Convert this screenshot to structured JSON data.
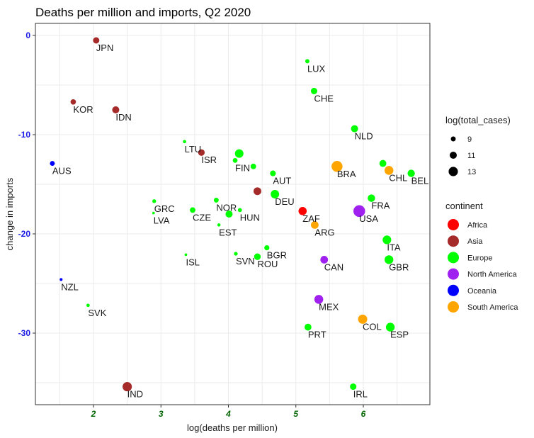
{
  "chart_data": {
    "type": "scatter",
    "title": "Deaths per million and imports, Q2 2020",
    "xlabel": "log(deaths per million)",
    "ylabel": "change in imports",
    "xlim": [
      1.2,
      7.0
    ],
    "ylim": [
      -37.3,
      2.0
    ],
    "xticks": [
      2,
      3,
      4,
      5,
      6
    ],
    "yticks": [
      0,
      -10,
      -20,
      -30
    ],
    "grid": true,
    "size_legend": {
      "title": "log(total_cases)",
      "entries": [
        9,
        11,
        13
      ],
      "placement": "right"
    },
    "color_legend": {
      "title": "continent",
      "placement": "right",
      "entries": [
        {
          "name": "Africa",
          "color": "#ff0000"
        },
        {
          "name": "Asia",
          "color": "#a52a2a"
        },
        {
          "name": "Europe",
          "color": "#00ff00"
        },
        {
          "name": "North America",
          "color": "#a020f0"
        },
        {
          "name": "Oceania",
          "color": "#0000ff"
        },
        {
          "name": "South America",
          "color": "#ffa500"
        }
      ]
    },
    "points": [
      {
        "label": "JPN",
        "x": 2.04,
        "y": -0.5,
        "continent": "Asia",
        "log_total_cases": 10.3
      },
      {
        "label": "KOR",
        "x": 1.7,
        "y": -6.7,
        "continent": "Asia",
        "log_total_cases": 9.5
      },
      {
        "label": "IDN",
        "x": 2.33,
        "y": -7.5,
        "continent": "Asia",
        "log_total_cases": 11.0
      },
      {
        "label": "AUS",
        "x": 1.39,
        "y": -12.9,
        "continent": "Oceania",
        "log_total_cases": 9.0
      },
      {
        "label": "NZL",
        "x": 1.52,
        "y": -24.6,
        "continent": "Oceania",
        "log_total_cases": 7.2
      },
      {
        "label": "SVK",
        "x": 1.92,
        "y": -27.2,
        "continent": "Europe",
        "log_total_cases": 7.6
      },
      {
        "label": "IND",
        "x": 2.5,
        "y": -35.4,
        "continent": "Asia",
        "log_total_cases": 13.0
      },
      {
        "label": "LTU",
        "x": 3.35,
        "y": -10.7,
        "continent": "Europe",
        "log_total_cases": 7.6
      },
      {
        "label": "ISR",
        "x": 3.6,
        "y": -11.8,
        "continent": "Asia",
        "log_total_cases": 10.5
      },
      {
        "label": "",
        "x": 4.16,
        "y": -11.9,
        "continent": "Europe",
        "log_total_cases": 12.3
      },
      {
        "label": "FIN",
        "x": 4.1,
        "y": -12.6,
        "continent": "Europe",
        "log_total_cases": 8.9
      },
      {
        "label": "",
        "x": 4.37,
        "y": -13.2,
        "continent": "Europe",
        "log_total_cases": 9.6
      },
      {
        "label": "AUT",
        "x": 4.66,
        "y": -13.9,
        "continent": "Europe",
        "log_total_cases": 9.8
      },
      {
        "label": "",
        "x": 4.43,
        "y": -15.7,
        "continent": "Asia",
        "log_total_cases": 11.6
      },
      {
        "label": "DEU",
        "x": 4.69,
        "y": -16.0,
        "continent": "Europe",
        "log_total_cases": 12.2
      },
      {
        "label": "GRC",
        "x": 2.9,
        "y": -16.7,
        "continent": "Europe",
        "log_total_cases": 8.0
      },
      {
        "label": "LVA",
        "x": 2.89,
        "y": -17.9,
        "continent": "Europe",
        "log_total_cases": 6.9
      },
      {
        "label": "CZE",
        "x": 3.47,
        "y": -17.6,
        "continent": "Europe",
        "log_total_cases": 9.6
      },
      {
        "label": "NOR",
        "x": 3.82,
        "y": -16.6,
        "continent": "Europe",
        "log_total_cases": 9.0
      },
      {
        "label": "",
        "x": 4.01,
        "y": -18.0,
        "continent": "Europe",
        "log_total_cases": 11.0
      },
      {
        "label": "HUN",
        "x": 4.17,
        "y": -17.6,
        "continent": "Europe",
        "log_total_cases": 8.3
      },
      {
        "label": "EST",
        "x": 3.86,
        "y": -19.1,
        "continent": "Europe",
        "log_total_cases": 7.5
      },
      {
        "label": "ZAF",
        "x": 5.1,
        "y": -17.7,
        "continent": "Africa",
        "log_total_cases": 12.0
      },
      {
        "label": "ARG",
        "x": 5.28,
        "y": -19.1,
        "continent": "South America",
        "log_total_cases": 11.5
      },
      {
        "label": "ISL",
        "x": 3.37,
        "y": -22.1,
        "continent": "Europe",
        "log_total_cases": 7.0
      },
      {
        "label": "SVN",
        "x": 4.11,
        "y": -22.0,
        "continent": "Europe",
        "log_total_cases": 8.0
      },
      {
        "label": "ROU",
        "x": 4.43,
        "y": -22.3,
        "continent": "Europe",
        "log_total_cases": 10.6
      },
      {
        "label": "BGR",
        "x": 4.57,
        "y": -21.4,
        "continent": "Europe",
        "log_total_cases": 9.2
      },
      {
        "label": "CAN",
        "x": 5.42,
        "y": -22.6,
        "continent": "North America",
        "log_total_cases": 11.5
      },
      {
        "label": "MEX",
        "x": 5.34,
        "y": -26.6,
        "continent": "North America",
        "log_total_cases": 12.6
      },
      {
        "label": "PRT",
        "x": 5.18,
        "y": -29.4,
        "continent": "Europe",
        "log_total_cases": 10.8
      },
      {
        "label": "LUX",
        "x": 5.17,
        "y": -2.6,
        "continent": "Europe",
        "log_total_cases": 8.4
      },
      {
        "label": "CHE",
        "x": 5.27,
        "y": -5.6,
        "continent": "Europe",
        "log_total_cases": 10.4
      },
      {
        "label": "NLD",
        "x": 5.87,
        "y": -9.4,
        "continent": "Europe",
        "log_total_cases": 11.0
      },
      {
        "label": "BRA",
        "x": 5.61,
        "y": -13.2,
        "continent": "South America",
        "log_total_cases": 14.5
      },
      {
        "label": "",
        "x": 6.29,
        "y": -12.9,
        "continent": "Europe",
        "log_total_cases": 10.9
      },
      {
        "label": "CHL",
        "x": 6.38,
        "y": -13.6,
        "continent": "South America",
        "log_total_cases": 12.6
      },
      {
        "label": "BEL",
        "x": 6.71,
        "y": -13.9,
        "continent": "Europe",
        "log_total_cases": 11.2
      },
      {
        "label": "FRA",
        "x": 6.12,
        "y": -16.4,
        "continent": "Europe",
        "log_total_cases": 11.3
      },
      {
        "label": "USA",
        "x": 5.94,
        "y": -17.7,
        "continent": "North America",
        "log_total_cases": 15.2
      },
      {
        "label": "ITA",
        "x": 6.35,
        "y": -20.6,
        "continent": "Europe",
        "log_total_cases": 12.4
      },
      {
        "label": "GBR",
        "x": 6.38,
        "y": -22.6,
        "continent": "Europe",
        "log_total_cases": 12.5
      },
      {
        "label": "COL",
        "x": 5.99,
        "y": -28.6,
        "continent": "South America",
        "log_total_cases": 12.9
      },
      {
        "label": "ESP",
        "x": 6.4,
        "y": -29.4,
        "continent": "Europe",
        "log_total_cases": 12.5
      },
      {
        "label": "IRL",
        "x": 5.85,
        "y": -35.4,
        "continent": "Europe",
        "log_total_cases": 10.4
      }
    ]
  }
}
